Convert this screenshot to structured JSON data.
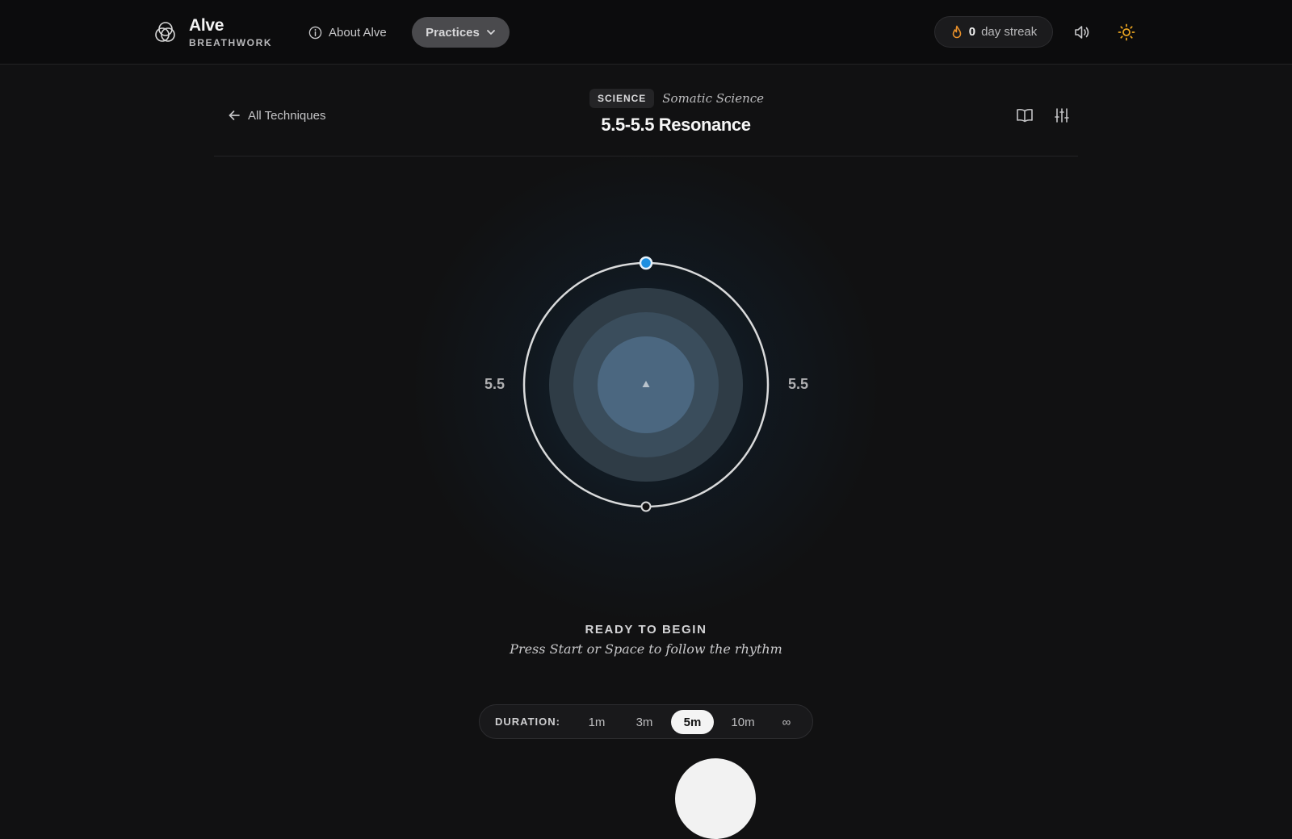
{
  "brand": {
    "name": "Alve",
    "subtitle": "BREATHWORK",
    "logo_icon": "breath-logo-icon"
  },
  "nav": {
    "about_label": "About Alve",
    "practices_label": "Practices"
  },
  "streak": {
    "count": "0",
    "label": "day streak",
    "icon_color": "#e8902a"
  },
  "header": {
    "back_label": "All Techniques",
    "tag": "SCIENCE",
    "category": "Somatic Science",
    "title": "5.5-5.5 Resonance"
  },
  "breath": {
    "inhale_seconds": "5.5",
    "exhale_seconds": "5.5",
    "accent_color": "#1d8fe0"
  },
  "status": {
    "title": "READY TO BEGIN",
    "hint": "Press Start or Space to follow the rhythm"
  },
  "duration": {
    "label": "DURATION:",
    "options": [
      "1m",
      "3m",
      "5m",
      "10m",
      "∞"
    ],
    "selected": "5m"
  }
}
